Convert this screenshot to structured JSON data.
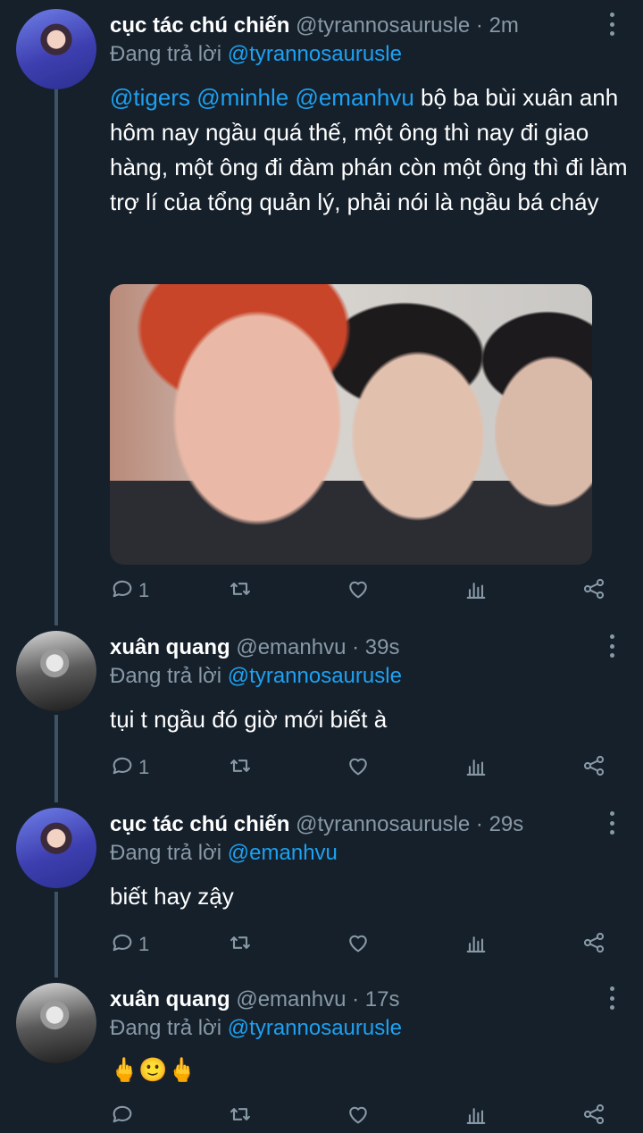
{
  "tweets": [
    {
      "display_name": "cục tác chú chiến",
      "handle": "@tyrannosaurusle",
      "separator": "·",
      "time": "2m",
      "reply_prefix": "Đang trả lời",
      "reply_to": "@tyrannosaurusle",
      "mentions": [
        "@tigers",
        "@minhle",
        "@emanhvu"
      ],
      "text": "bộ ba bùi xuân anh hôm nay ngầu quá thế, một ông thì nay đi giao hàng, một ông đi đàm phán còn một ông thì đi làm trợ lí của tổng quản lý, phải nói là ngầu bá cháy",
      "reply_count": "1",
      "avatar": "avatar-blue-boy"
    },
    {
      "display_name": "xuân quang",
      "handle": "@emanhvu",
      "separator": "·",
      "time": "39s",
      "reply_prefix": "Đang trả lời",
      "reply_to": "@tyrannosaurusle",
      "text": "tụi t ngầu đó giờ mới biết à",
      "reply_count": "1",
      "avatar": "avatar-monochrome"
    },
    {
      "display_name": "cục tác chú chiến",
      "handle": "@tyrannosaurusle",
      "separator": "·",
      "time": "29s",
      "reply_prefix": "Đang trả lời",
      "reply_to": "@emanhvu",
      "text": "biết hay zậy",
      "reply_count": "1",
      "avatar": "avatar-blue-boy"
    },
    {
      "display_name": "xuân quang",
      "handle": "@emanhvu",
      "separator": "·",
      "time": "17s",
      "reply_prefix": "Đang trả lời",
      "reply_to": "@tyrannosaurusle",
      "text": "🖕🙂🖕",
      "reply_count": "",
      "avatar": "avatar-monochrome"
    }
  ],
  "icons": {
    "reply": "reply-icon",
    "retweet": "retweet-icon",
    "like": "like-icon",
    "analytics": "analytics-icon",
    "share": "share-icon",
    "more": "more-vertical-icon"
  },
  "colors": {
    "background": "#15202b",
    "accent": "#1da1f2",
    "muted": "#8899a6",
    "thread_line": "#3d5466"
  }
}
